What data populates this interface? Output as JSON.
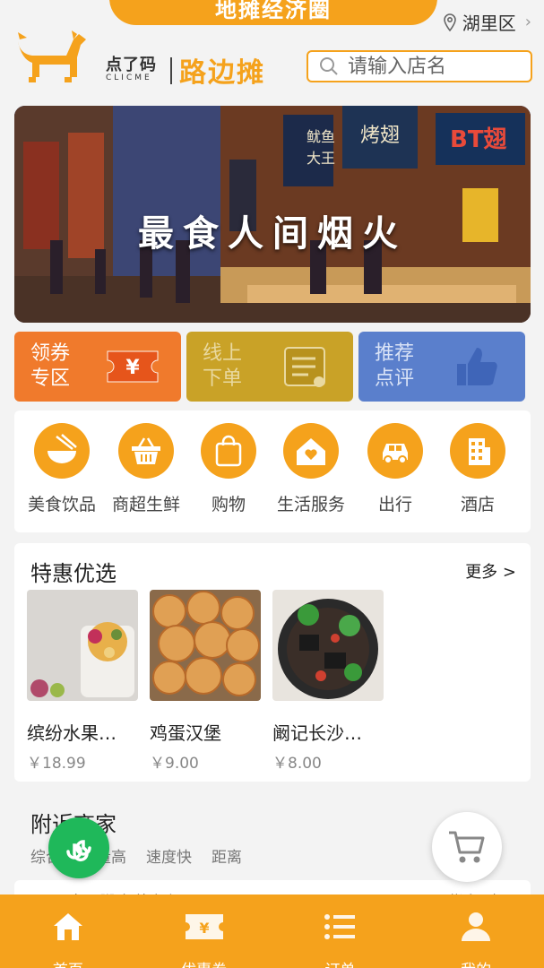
{
  "top_banner": "地摊经济圈",
  "location": "湖里区",
  "brand": {
    "small_cn": "点了码",
    "small_en": "CLICME",
    "big": "路边摊"
  },
  "search": {
    "placeholder": "请输入店名"
  },
  "hero": {
    "slogan": "最食人间烟火",
    "signs": [
      "鱿鱼大王",
      "烤翅",
      "BT翅"
    ]
  },
  "tiles": [
    {
      "label_line1": "领券",
      "label_line2": "专区",
      "icon": "yen-ticket-icon",
      "color": "#f07a2c"
    },
    {
      "label_line1": "线上",
      "label_line2": "下单",
      "icon": "order-list-icon",
      "color": "#c9a227"
    },
    {
      "label_line1": "推荐",
      "label_line2": "点评",
      "icon": "thumbs-up-icon",
      "color": "#5a7fcc"
    }
  ],
  "categories": [
    {
      "label": "美食饮品",
      "icon": "bowl-icon"
    },
    {
      "label": "商超生鲜",
      "icon": "basket-icon"
    },
    {
      "label": "购物",
      "icon": "shopping-bag-icon"
    },
    {
      "label": "生活服务",
      "icon": "home-heart-icon"
    },
    {
      "label": "出行",
      "icon": "car-icon"
    },
    {
      "label": "酒店",
      "icon": "hotel-icon"
    }
  ],
  "specials": {
    "title": "特惠优选",
    "more": "更多 >",
    "items": [
      {
        "name": "缤纷水果…",
        "price": "￥18.99"
      },
      {
        "name": "鸡蛋汉堡",
        "price": "￥9.00"
      },
      {
        "name": "阚记长沙…",
        "price": "￥8.00"
      }
    ]
  },
  "nearby": {
    "title": "附近商家",
    "filters": [
      "综合",
      "销量高",
      "速度快",
      "距离"
    ],
    "peek_left": "每天粥鸡(外卖店)",
    "peek_right": "附近距离："
  },
  "bottom_nav": [
    {
      "label": "首页",
      "icon": "home-icon"
    },
    {
      "label": "优惠券",
      "icon": "coupon-icon"
    },
    {
      "label": "订单",
      "icon": "list-icon"
    },
    {
      "label": "我的",
      "icon": "user-icon"
    }
  ],
  "colors": {
    "brand_orange": "#f5a21c",
    "tile_orange": "#f07a2c",
    "tile_gold": "#c9a227",
    "tile_blue": "#5a7fcc",
    "mini_app_green": "#1fb85a"
  }
}
